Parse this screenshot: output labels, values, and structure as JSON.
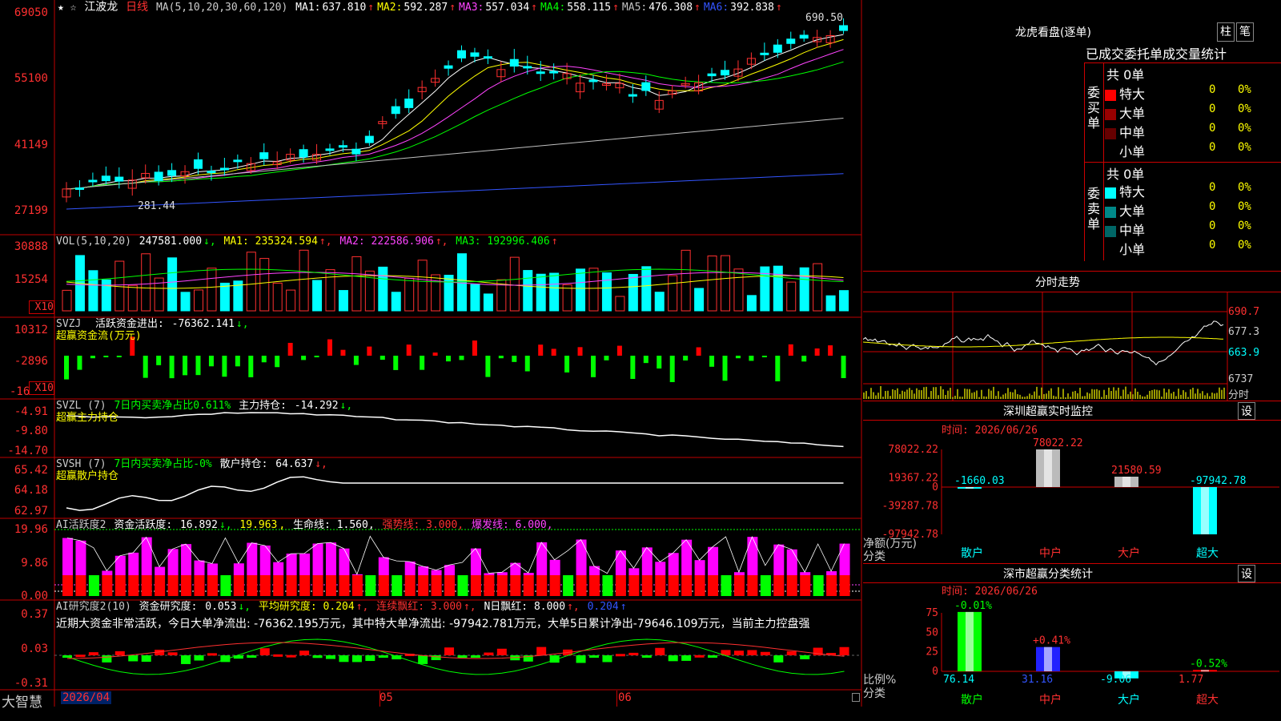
{
  "app": {
    "brand": "大智慧",
    "date_start": "2026/04",
    "months": [
      "05",
      "06"
    ]
  },
  "panels": {
    "main": {
      "stock_name": "江波龙",
      "period": "日线",
      "params": "MA(5,10,20,30,60,120)",
      "ma": [
        {
          "label": "MA1:",
          "value": "637.810",
          "color": "#ffffff"
        },
        {
          "label": "MA2:",
          "value": "592.287",
          "color": "#ffff00"
        },
        {
          "label": "MA3:",
          "value": "557.034",
          "color": "#ff44ff"
        },
        {
          "label": "MA4:",
          "value": "558.115",
          "color": "#00ff00"
        },
        {
          "label": "MA5:",
          "value": "476.308",
          "color": "#c0c0c0"
        },
        {
          "label": "MA6:",
          "value": "392.838",
          "color": "#3355ff"
        }
      ],
      "ticks": [
        "69050",
        "55100",
        "41149",
        "27199"
      ],
      "high_mark": "690.50",
      "low_mark": "281.44"
    },
    "vol": {
      "title": "VOL(5,10,20)",
      "value": "247581.000",
      "ma1": "MA1: 235324.594",
      "ma2": "MA2: 222586.906",
      "ma3": "MA3: 192996.406",
      "ticks": [
        "30888",
        "15254"
      ],
      "unit": "X10"
    },
    "svzj": {
      "title": "SVZJ",
      "name": "活跃资金进出:",
      "value": "-76362.141",
      "sub": "超赢资金流(万元)",
      "ticks": [
        "10312",
        "-2896",
        "-16"
      ],
      "unit": "X10"
    },
    "svzl": {
      "title": "SVZL (7)",
      "ratio": "7日内买卖净占比0.611%",
      "name": "主力持仓:",
      "value": "-14.292",
      "sub": "超赢主力持仓",
      "ticks": [
        "-4.91",
        "-9.80",
        "-14.70"
      ]
    },
    "svsh": {
      "title": "SVSH (7)",
      "ratio": "7日内买卖净占比-0%",
      "name": "散户持仓:",
      "value": "64.637",
      "sub": "超赢散户持仓",
      "ticks": [
        "65.42",
        "64.18",
        "62.97"
      ]
    },
    "ai_active": {
      "title": "AI活跃度2",
      "name": "资金活跃度:",
      "value": "16.892",
      "v2": "19.963",
      "life": "生命线: 1.560,",
      "strong": "强势线: 3.000,",
      "burst": "爆发线: 6.000,",
      "ticks": [
        "19.96",
        "9.86",
        "0.00"
      ]
    },
    "ai_research": {
      "title": "AI研究度2(10)",
      "name": "资金研究度:",
      "value": "0.053",
      "avg": "平均研究度: 0.204",
      "red": "连续飘红: 3.000",
      "nred": "N日飘红: 8.000",
      "last": "0.204",
      "text": "近期大资金非常活跃，今日大单净流出: -76362.195万元，其中特大单净流出: -97942.781万元，大单5日累计净出-79646.109万元，当前主力控盘强",
      "ticks": [
        "0.37",
        "0.03",
        "-0.31"
      ]
    }
  },
  "right": {
    "lhb": {
      "title": "龙虎看盘(逐单)",
      "btn1": "柱",
      "btn2": "笔",
      "header": "已成交委托单成交量统计",
      "buy": {
        "side": "委买单",
        "total": "共 0单",
        "rows": [
          {
            "label": "特大",
            "count": "0",
            "pct": "0%",
            "color": "#ff0000"
          },
          {
            "label": "大单",
            "count": "0",
            "pct": "0%",
            "color": "#990000"
          },
          {
            "label": "中单",
            "count": "0",
            "pct": "0%",
            "color": "#660000"
          },
          {
            "label": "小单",
            "count": "0",
            "pct": "0%",
            "color": ""
          }
        ]
      },
      "sell": {
        "side": "委卖单",
        "total": "共 0单",
        "rows": [
          {
            "label": "特大",
            "count": "0",
            "pct": "0%",
            "color": "#00ffff"
          },
          {
            "label": "大单",
            "count": "0",
            "pct": "0%",
            "color": "#008888"
          },
          {
            "label": "中单",
            "count": "0",
            "pct": "0%",
            "color": "#006666"
          },
          {
            "label": "小单",
            "count": "0",
            "pct": "0%",
            "color": ""
          }
        ]
      }
    },
    "intraday": {
      "title": "分时走势",
      "ticks": [
        "690.7",
        "677.3",
        "663.9",
        "6737"
      ],
      "unit": "分时"
    },
    "sz_monitor": {
      "title": "深圳超赢实时监控",
      "btn": "设",
      "time": "时间: 2026/06/26",
      "ylabel": "净额(万元)",
      "xlabel": "分类",
      "ticks": [
        "78022.22",
        "19367.22",
        "0",
        "-39287.78",
        "-97942.78"
      ]
    },
    "sz_stats": {
      "title": "深市超赢分类统计",
      "btn": "设",
      "time": "时间: 2026/06/26",
      "ylabel": "比例%",
      "xlabel": "分类",
      "ticks": [
        "75",
        "50",
        "25",
        "0"
      ]
    }
  },
  "chart_data": [
    {
      "type": "bar",
      "title": "深圳超赢实时监控",
      "categories": [
        "散户",
        "中户",
        "大户",
        "超大"
      ],
      "values": [
        -1660.03,
        78022.22,
        21580.59,
        -97942.78
      ],
      "ylim": [
        -97942.78,
        78022.22
      ],
      "ylabel": "净额(万元)",
      "xlabel": "分类"
    },
    {
      "type": "bar",
      "title": "深市超赢分类统计",
      "categories": [
        "散户",
        "中户",
        "大户",
        "超大"
      ],
      "values": [
        76.14,
        31.16,
        -9.06,
        1.77
      ],
      "changes": [
        "-0.01%",
        "+0.41%",
        "",
        "-0.52%"
      ],
      "ylim": [
        0,
        75
      ],
      "ylabel": "比例%",
      "xlabel": "分类"
    }
  ]
}
